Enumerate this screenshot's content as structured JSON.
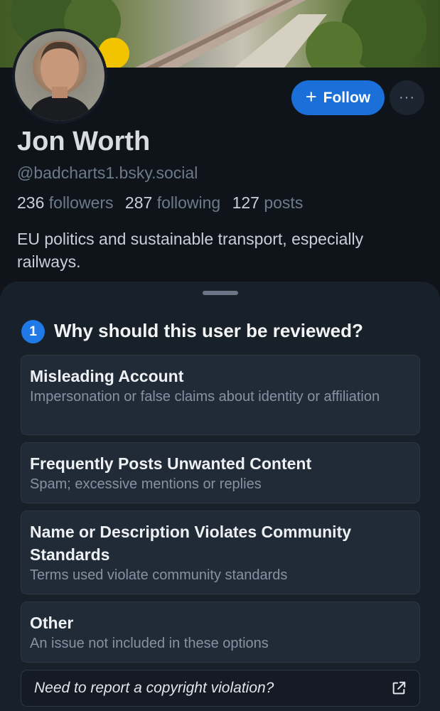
{
  "profile": {
    "display_name": "Jon Worth",
    "handle": "@badcharts1.bsky.social",
    "followers_count": "236",
    "followers_label": "followers",
    "following_count": "287",
    "following_label": "following",
    "posts_count": "127",
    "posts_label": "posts",
    "bio": "EU politics and sustainable transport, especially railways."
  },
  "actions": {
    "follow_icon": "+",
    "follow_label": "Follow",
    "more_label": "···"
  },
  "report": {
    "step_number": "1",
    "title": "Why should this user be reviewed?",
    "options": [
      {
        "title": "Misleading Account",
        "description": "Impersonation or false claims about identity or affiliation"
      },
      {
        "title": "Frequently Posts Unwanted Content",
        "description": "Spam; excessive mentions or replies"
      },
      {
        "title": "Name or Description Violates Community Standards",
        "description": "Terms used violate community standards"
      },
      {
        "title": "Other",
        "description": "An issue not included in these options"
      }
    ],
    "copyright_link": "Need to report a copyright violation?",
    "copyright_icon": "external-link-icon"
  },
  "colors": {
    "accent": "#1a6fd8",
    "sheet_background": "#18202a",
    "page_background": "#0f141b"
  }
}
